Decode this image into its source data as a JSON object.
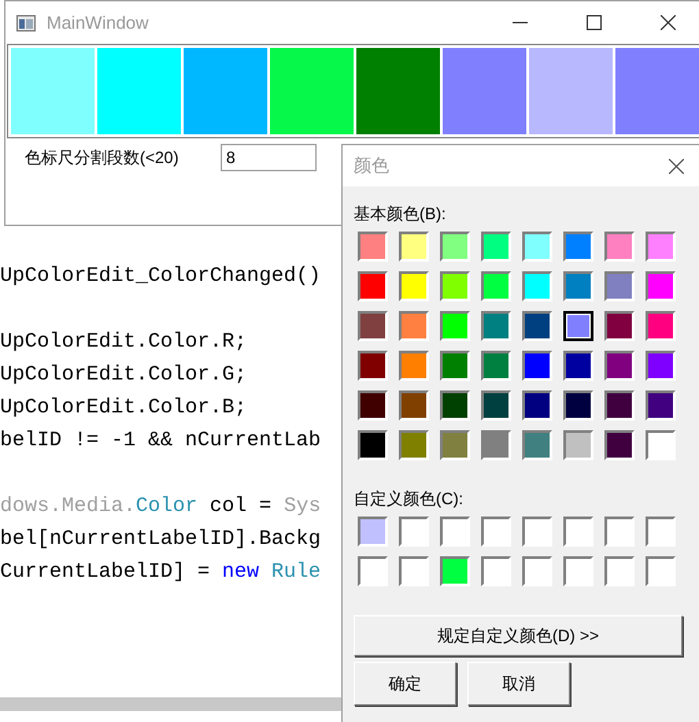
{
  "editor": {
    "blocks": [
      [
        {
          "segments": [
            {
              "text": "UpColorEdit_ColorChanged()",
              "kind": "plain"
            }
          ]
        }
      ],
      [
        {
          "segments": [
            {
              "text": "UpColorEdit.Color.R;",
              "kind": "plain"
            }
          ]
        },
        {
          "segments": [
            {
              "text": "UpColorEdit.Color.G;",
              "kind": "plain"
            }
          ]
        },
        {
          "segments": [
            {
              "text": "UpColorEdit.Color.B;",
              "kind": "plain"
            }
          ]
        },
        {
          "segments": [
            {
              "text": "belID != -1 && nCurrentLab",
              "kind": "plain"
            }
          ]
        }
      ],
      [
        {
          "segments": [
            {
              "text": "dows.Media.",
              "kind": "muted"
            },
            {
              "text": "Color",
              "kind": "type"
            },
            {
              "text": " col = ",
              "kind": "plain"
            },
            {
              "text": "Sys",
              "kind": "muted"
            }
          ]
        },
        {
          "segments": [
            {
              "text": "bel[nCurrentLabelID].Backg",
              "kind": "plain"
            }
          ]
        },
        {
          "segments": [
            {
              "text": "CurrentLabelID] = ",
              "kind": "plain"
            },
            {
              "text": "new",
              "kind": "keyword"
            },
            {
              "text": " Rule",
              "kind": "type"
            }
          ]
        }
      ]
    ]
  },
  "main_window": {
    "title": "MainWindow",
    "swatches": [
      {
        "color": "#80ffff"
      },
      {
        "color": "#00ffff"
      },
      {
        "color": "#00b8ff"
      },
      {
        "color": "#05f84a"
      },
      {
        "color": "#008000"
      },
      {
        "color": "#8080ff"
      },
      {
        "color": "#b8b8ff"
      },
      {
        "color": "#8080ff"
      }
    ],
    "segments_label": "色标尺分割段数(<20)",
    "segments_value": "8"
  },
  "color_dialog": {
    "title": "颜色",
    "basic_label": "基本颜色(B):",
    "basic_colors": [
      {
        "color": "#ff8080",
        "selected": false
      },
      {
        "color": "#ffff80",
        "selected": false
      },
      {
        "color": "#80ff80",
        "selected": false
      },
      {
        "color": "#00ff80",
        "selected": false
      },
      {
        "color": "#80ffff",
        "selected": false
      },
      {
        "color": "#0080ff",
        "selected": false
      },
      {
        "color": "#ff80c0",
        "selected": false
      },
      {
        "color": "#ff80ff",
        "selected": false
      },
      {
        "color": "#ff0000",
        "selected": false
      },
      {
        "color": "#ffff00",
        "selected": false
      },
      {
        "color": "#80ff00",
        "selected": false
      },
      {
        "color": "#00ff40",
        "selected": false
      },
      {
        "color": "#00ffff",
        "selected": false
      },
      {
        "color": "#0080c0",
        "selected": false
      },
      {
        "color": "#8080c0",
        "selected": false
      },
      {
        "color": "#ff00ff",
        "selected": false
      },
      {
        "color": "#804040",
        "selected": false
      },
      {
        "color": "#ff8040",
        "selected": false
      },
      {
        "color": "#00ff00",
        "selected": false
      },
      {
        "color": "#008080",
        "selected": false
      },
      {
        "color": "#004080",
        "selected": false
      },
      {
        "color": "#8080ff",
        "selected": true
      },
      {
        "color": "#800040",
        "selected": false
      },
      {
        "color": "#ff0080",
        "selected": false
      },
      {
        "color": "#800000",
        "selected": false
      },
      {
        "color": "#ff8000",
        "selected": false
      },
      {
        "color": "#008000",
        "selected": false
      },
      {
        "color": "#008040",
        "selected": false
      },
      {
        "color": "#0000ff",
        "selected": false
      },
      {
        "color": "#0000a0",
        "selected": false
      },
      {
        "color": "#800080",
        "selected": false
      },
      {
        "color": "#8000ff",
        "selected": false
      },
      {
        "color": "#400000",
        "selected": false
      },
      {
        "color": "#804000",
        "selected": false
      },
      {
        "color": "#004000",
        "selected": false
      },
      {
        "color": "#004040",
        "selected": false
      },
      {
        "color": "#000080",
        "selected": false
      },
      {
        "color": "#000040",
        "selected": false
      },
      {
        "color": "#400040",
        "selected": false
      },
      {
        "color": "#400080",
        "selected": false
      },
      {
        "color": "#000000",
        "selected": false
      },
      {
        "color": "#808000",
        "selected": false
      },
      {
        "color": "#808040",
        "selected": false
      },
      {
        "color": "#808080",
        "selected": false
      },
      {
        "color": "#408080",
        "selected": false
      },
      {
        "color": "#c0c0c0",
        "selected": false
      },
      {
        "color": "#400040",
        "selected": false
      },
      {
        "color": "#ffffff",
        "selected": false
      }
    ],
    "custom_label": "自定义颜色(C):",
    "custom_colors": [
      {
        "color": "#c0c0ff"
      },
      {
        "color": "#ffffff"
      },
      {
        "color": "#ffffff"
      },
      {
        "color": "#ffffff"
      },
      {
        "color": "#ffffff"
      },
      {
        "color": "#ffffff"
      },
      {
        "color": "#ffffff"
      },
      {
        "color": "#ffffff"
      },
      {
        "color": "#ffffff"
      },
      {
        "color": "#ffffff"
      },
      {
        "color": "#00ff40"
      },
      {
        "color": "#ffffff"
      },
      {
        "color": "#ffffff"
      },
      {
        "color": "#ffffff"
      },
      {
        "color": "#ffffff"
      },
      {
        "color": "#ffffff"
      }
    ],
    "define_button": "规定自定义颜色(D) >>",
    "buttons": [
      "确定",
      "取消"
    ]
  }
}
